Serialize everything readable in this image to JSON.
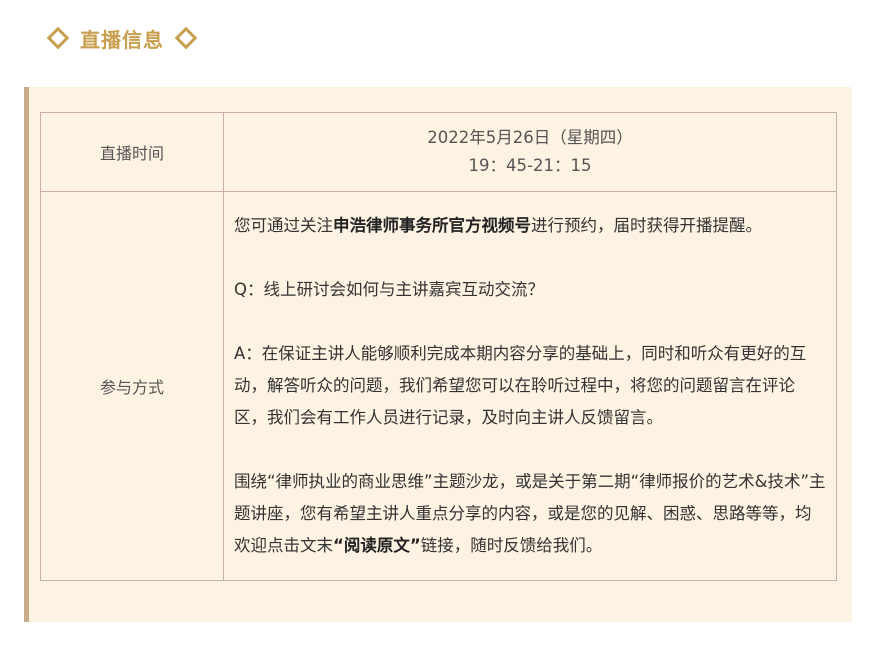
{
  "header": {
    "title": "直播信息",
    "icon_left": "diamond-icon",
    "icon_right": "diamond-icon",
    "accent_color": "#c9a04f"
  },
  "panel": {
    "background": "#fdf3e3",
    "border_color": "#c9ac8b"
  },
  "table": {
    "time_label": "直播时间",
    "date_line": "2022年5月26日（星期四）",
    "time_line": "19：45-21：15",
    "method_label": "参与方式",
    "p1_pre": "您可通过关注",
    "p1_bold": "申浩律师事务所官方视频号",
    "p1_post": "进行预约，届时获得开播提醒。",
    "p2": "Q：线上研讨会如何与主讲嘉宾互动交流？",
    "p3": "A：在保证主讲人能够顺利完成本期内容分享的基础上，同时和听众有更好的互动，解答听众的问题，我们希望您可以在聆听过程中，将您的问题留言在评论区，我们会有工作人员进行记录，及时向主讲人反馈留言。",
    "p4_pre": "围绕“律师执业的商业思维”主题沙龙，或是关于第二期“律师报价的艺术&技术”主题讲座，您有希望主讲人重点分享的内容，或是您的见解、困惑、思路等等，均欢迎点击文末",
    "p4_bold": "“阅读原文”",
    "p4_post": "链接，随时反馈给我们。"
  }
}
